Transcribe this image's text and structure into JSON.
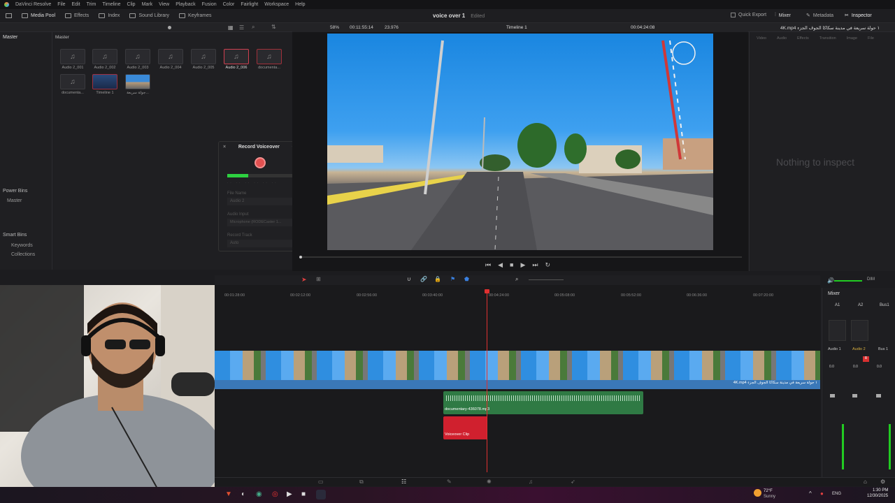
{
  "titlebar": {
    "app": "DaVinci Resolve",
    "menus": [
      "File",
      "Edit",
      "Trim",
      "Timeline",
      "Clip",
      "Mark",
      "View",
      "Playback",
      "Fusion",
      "Color",
      "Fairlight",
      "Workspace",
      "Help"
    ]
  },
  "toolbar": {
    "left": [
      "Media Pool",
      "Effects",
      "Index",
      "Sound Library",
      "Keyframes"
    ],
    "project_name": "voice over 1",
    "project_status": "Edited",
    "right": [
      "Quick Export",
      "Mixer",
      "Metadata",
      "Inspector"
    ]
  },
  "viewer": {
    "zoom": "58%",
    "timecode_left": "00:11:55:14",
    "fps": "23.976",
    "timeline_name": "Timeline 1",
    "timecode_right": "00:04:24:08",
    "clip_title": "4K.mp4 ١ حولة سريعة في مدينة سكاكا الجوف الجزء"
  },
  "media_pool": {
    "left_title": "Master",
    "right_title": "Master",
    "clips": [
      "Audio 2_001",
      "Audio 2_002",
      "Audio 2_003",
      "Audio 2_004",
      "Audio 2_005",
      "Audio 2_006",
      "documenta...",
      "documenta...",
      "Timeline 1",
      "جولة سريعة..."
    ],
    "power_bins": "Power Bins",
    "power_master": "Master",
    "smart_bins": "Smart Bins",
    "smart_items": [
      "Keywords",
      "Collections"
    ]
  },
  "voiceover": {
    "title": "Record Voiceover",
    "file_name_label": "File Name",
    "file_name": "Audio 2",
    "audio_input_label": "Audio Input",
    "audio_input": "Microphone (RODECaster 1...",
    "record_track_label": "Record Track",
    "record_track": "Auto",
    "meter_level": 0.32
  },
  "inspector": {
    "tabs": [
      "Video",
      "Audio",
      "Effects",
      "Transition",
      "Image",
      "File"
    ],
    "empty": "Nothing to inspect"
  },
  "timeline": {
    "ruler": [
      "00:01:28:00",
      "00:02:12:00",
      "00:02:56:00",
      "00:03:40:00",
      "00:04:24:00",
      "00:05:08:00",
      "00:05:52:00",
      "00:06:36:00",
      "00:07:20:00"
    ],
    "video_clip": "4K.mp4 ١ جولة سريعة في مدينة سكاكا الجوف الجزء",
    "audio_clip": "documentary-436078.mp3",
    "voice_clip": "Voiceover Clip"
  },
  "mixer": {
    "title": "Mixer",
    "channels": [
      "A1",
      "A2",
      "Bus1"
    ],
    "names": [
      "Audio 1",
      "Audio 2",
      "Bus 1"
    ],
    "vals": [
      "0.0",
      "0.0",
      "0.0"
    ],
    "dim": "DIM"
  },
  "taskbar": {
    "temp": "72°F",
    "weather": "Sunny",
    "lang": "ENG",
    "time": "1:30 PM",
    "date": "12/30/2025"
  },
  "colors": {
    "accent": "#e0202e",
    "green": "#2f7a44",
    "video_track": "#3a78b8"
  }
}
